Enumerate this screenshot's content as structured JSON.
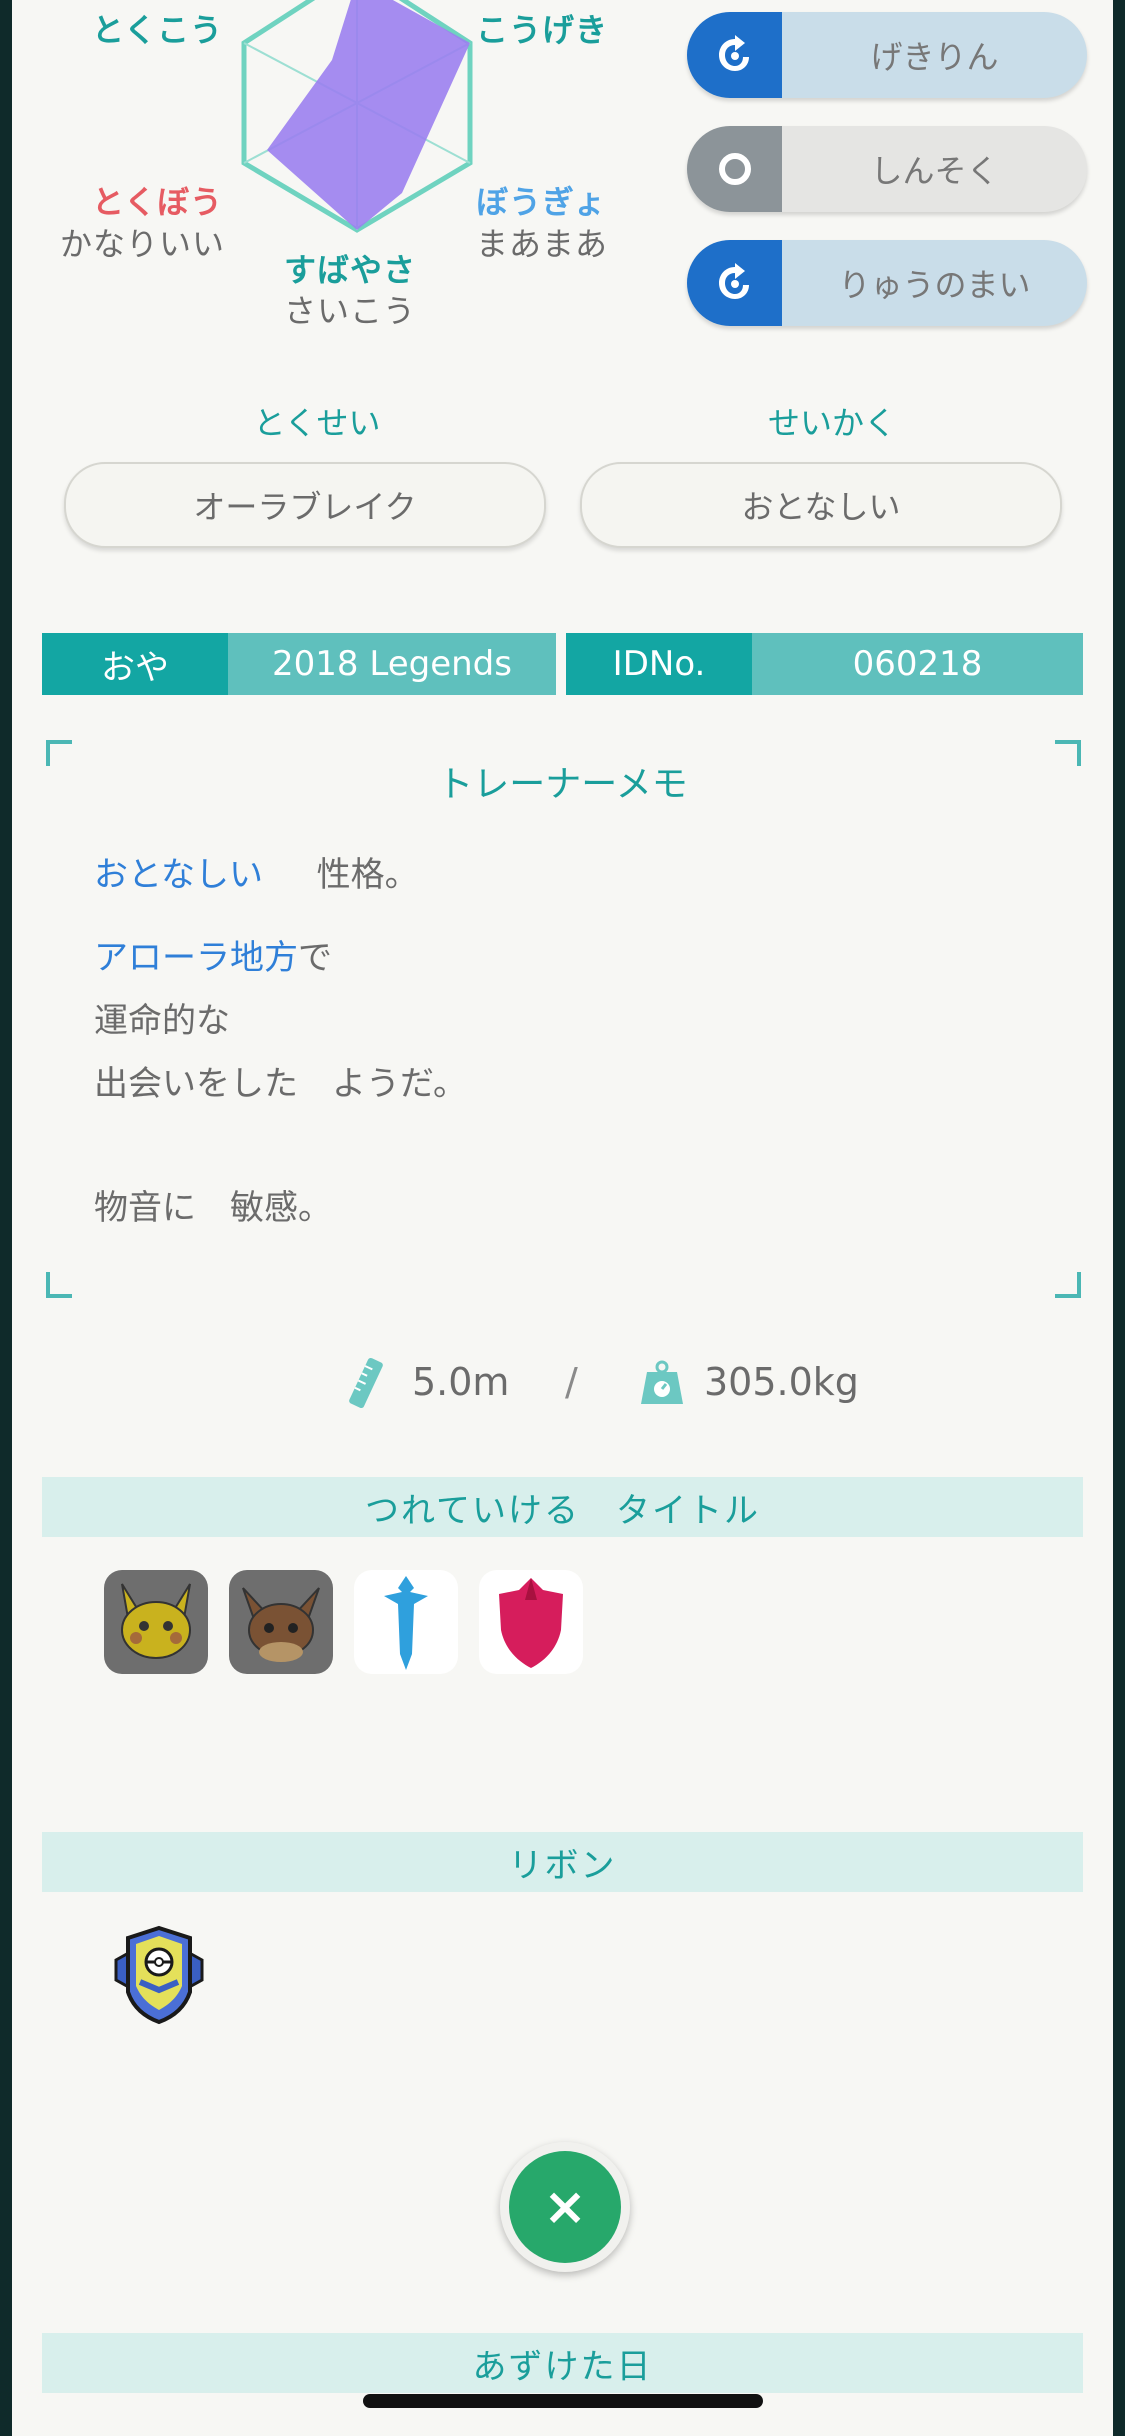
{
  "stats": {
    "top_left": "とくこう",
    "top_right": "こうげき",
    "bottom_left": "とくぼう",
    "bottom_left_value": "かなりいい",
    "bottom_right": "ぼうぎょ",
    "bottom_right_value": "まあまあ",
    "bottom": "すばやさ",
    "bottom_value": "さいこう"
  },
  "moves": [
    {
      "name": "げきりん",
      "type_icon": "dragon-type-icon"
    },
    {
      "name": "しんそく",
      "type_icon": "normal-type-icon"
    },
    {
      "name": "りゅうのまい",
      "type_icon": "dragon-type-icon"
    }
  ],
  "ability": {
    "label": "とくせい",
    "value": "オーラブレイク"
  },
  "nature": {
    "label": "せいかく",
    "value": "おとなしい"
  },
  "ot": {
    "label": "おや",
    "value": "2018 Legends",
    "id_label": "IDNo.",
    "id_value": "060218"
  },
  "memo": {
    "title": "トレーナーメモ",
    "nature_word": "おとなしい",
    "nature_suffix": "性格。",
    "region": "アローラ地方",
    "region_suffix": "で",
    "line2": "運命的な",
    "line3": "出会いをした　ようだ。",
    "trait": "物音に　敏感。"
  },
  "measure": {
    "height": "5.0m",
    "separator": "/",
    "weight": "305.0kg"
  },
  "titles_header": "つれていける　タイトル",
  "titles": [
    "pikachu-icon",
    "eevee-icon",
    "sword-icon",
    "shield-icon"
  ],
  "ribbons_header": "リボン",
  "ribbons": [
    "ribbon-badge-icon"
  ],
  "close_label": "×",
  "deposit_header": "あずけた日",
  "colors": {
    "teal": "#1a9e9b",
    "teal_light": "#5fc0bd",
    "dragon_blue": "#1e6fc9",
    "normal_gray": "#8c9499",
    "radar_purple": "#9b7ff0"
  }
}
